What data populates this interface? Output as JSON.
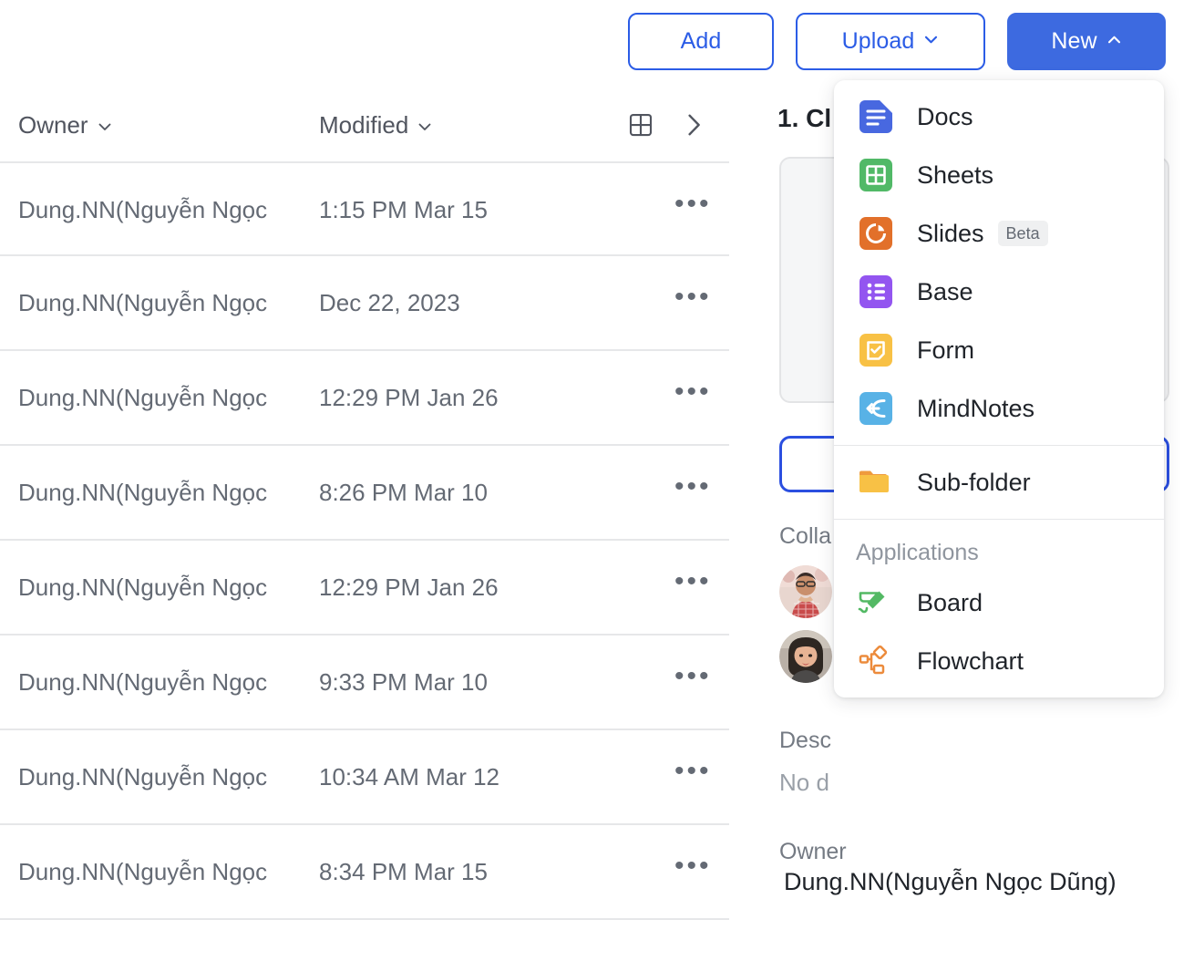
{
  "toolbar": {
    "add_label": "Add",
    "upload_label": "Upload",
    "new_label": "New",
    "upload_caret": "chevron-down-icon",
    "new_caret": "chevron-up-icon",
    "accent_color": "#2b5ce6",
    "primary_bg": "#3d6ae0"
  },
  "file_list": {
    "columns": [
      {
        "key": "owner",
        "label": "Owner",
        "sortable": true
      },
      {
        "key": "modified",
        "label": "Modified",
        "sortable": true
      }
    ],
    "header_icons": [
      {
        "name": "grid-view-icon"
      },
      {
        "name": "chevron-right-icon"
      }
    ],
    "row_menu_glyph": "•••",
    "rows": [
      {
        "owner": "Dung.NN(Nguyễn Ngọc",
        "modified": "1:15 PM Mar 15"
      },
      {
        "owner": "Dung.NN(Nguyễn Ngọc",
        "modified": "Dec 22, 2023"
      },
      {
        "owner": "Dung.NN(Nguyễn Ngọc",
        "modified": "12:29 PM Jan 26"
      },
      {
        "owner": "Dung.NN(Nguyễn Ngọc",
        "modified": "8:26 PM Mar 10"
      },
      {
        "owner": "Dung.NN(Nguyễn Ngọc",
        "modified": "12:29 PM Jan 26"
      },
      {
        "owner": "Dung.NN(Nguyễn Ngọc",
        "modified": "9:33 PM Mar 10"
      },
      {
        "owner": "Dung.NN(Nguyễn Ngọc",
        "modified": "10:34 AM Mar 12"
      },
      {
        "owner": "Dung.NN(Nguyễn Ngọc",
        "modified": "8:34 PM Mar 15"
      }
    ]
  },
  "detail_panel": {
    "title": "1. Cl",
    "collaborators_label": "Colla",
    "collaborators": [
      {
        "name": "avatar-collaborator-1"
      },
      {
        "name": "avatar-collaborator-2"
      }
    ],
    "description_label": "Desc",
    "description_value": "No d",
    "owner_label": "Owner",
    "owner_value": "Dung.NN(Nguyễn Ngọc Dũng)"
  },
  "new_menu": {
    "documents": [
      {
        "label": "Docs",
        "icon": "docs-icon",
        "color": "#4868e0",
        "badge": ""
      },
      {
        "label": "Sheets",
        "icon": "sheets-icon",
        "color": "#51b967",
        "badge": ""
      },
      {
        "label": "Slides",
        "icon": "slides-icon",
        "color": "#e2702a",
        "badge": "Beta"
      },
      {
        "label": "Base",
        "icon": "base-icon",
        "color": "#9355f0",
        "badge": ""
      },
      {
        "label": "Form",
        "icon": "form-icon",
        "color": "#f8c145",
        "badge": ""
      },
      {
        "label": "MindNotes",
        "icon": "mindnotes-icon",
        "color": "#58b2e6",
        "badge": ""
      }
    ],
    "folder": [
      {
        "label": "Sub-folder",
        "icon": "folder-icon",
        "color": "#f8c145",
        "badge": ""
      }
    ],
    "applications_title": "Applications",
    "applications": [
      {
        "label": "Board",
        "icon": "board-icon",
        "color": "#53b964",
        "badge": ""
      },
      {
        "label": "Flowchart",
        "icon": "flowchart-icon",
        "color": "#ec8b3c",
        "badge": ""
      }
    ]
  }
}
